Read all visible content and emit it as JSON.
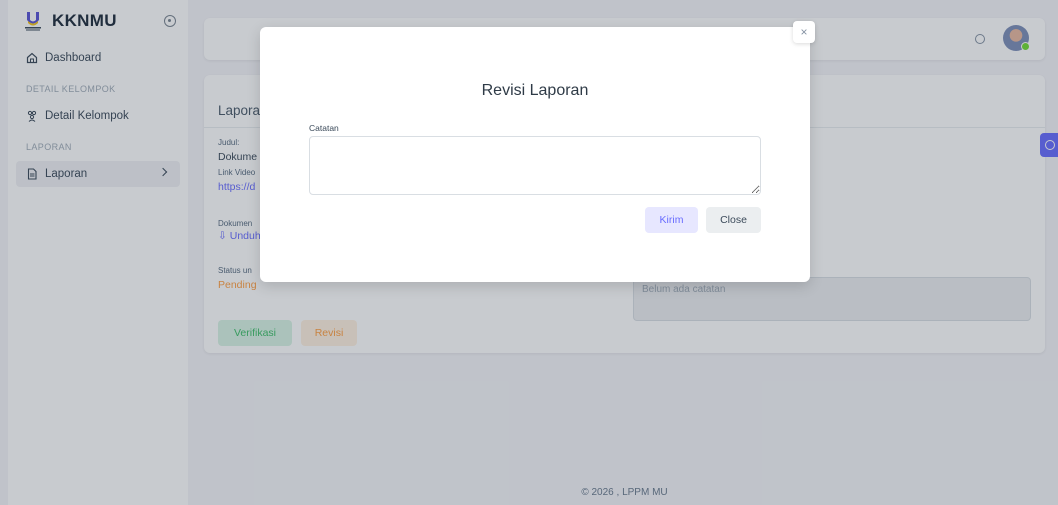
{
  "sidebar": {
    "brand": "KKNMU",
    "items": [
      {
        "label": "Dashboard"
      },
      {
        "header": "DETAIL KELOMPOK"
      },
      {
        "label": "Detail Kelompok"
      },
      {
        "header": "LAPORAN"
      },
      {
        "label": "Laporan"
      }
    ]
  },
  "card": {
    "title": "Lapora",
    "judul_label": "Judul:",
    "judul_value": "Dokume",
    "link_label": "Link Video",
    "link_value": "https://d",
    "dokumen_label": "Dokumen",
    "unduh_label": "Unduh",
    "status_label": "Status un",
    "status_value": "Pending",
    "notes_placeholder": "Belum ada catatan",
    "verifikasi_label": "Verifikasi",
    "revisi_label": "Revisi"
  },
  "modal": {
    "title": "Revisi Laporan",
    "catatan_label": "Catatan",
    "catatan_value": "",
    "kirim_label": "Kirim",
    "close_label": "Close",
    "x_label": "×"
  },
  "footer": {
    "text": "© 2026 , LPPM MU"
  },
  "colors": {
    "primary": "#696cff",
    "success": "#71dd37",
    "warning": "#ff9f43"
  }
}
